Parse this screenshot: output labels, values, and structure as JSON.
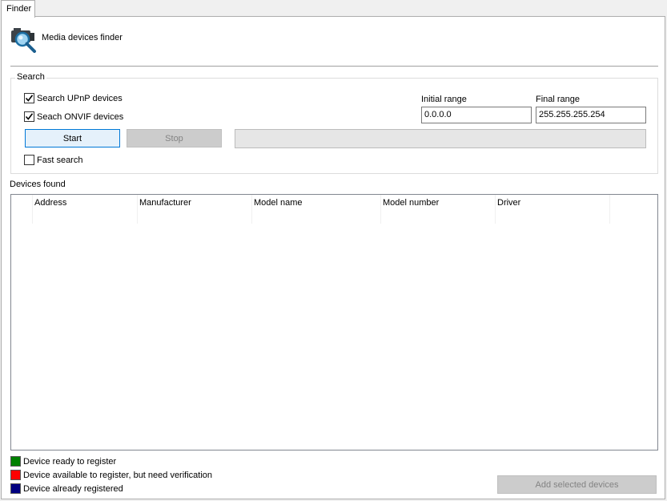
{
  "tab": {
    "label": "Finder"
  },
  "header": {
    "title": "Media devices finder",
    "icon": "camera-search-icon"
  },
  "search": {
    "group_label": "Search",
    "upnp": {
      "label": "Search UPnP devices",
      "checked": true
    },
    "onvif": {
      "label": "Seach ONVIF devices",
      "checked": true
    },
    "fast": {
      "label": "Fast search",
      "checked": false
    },
    "start_label": "Start",
    "stop_label": "Stop",
    "progress": 0,
    "initial_range": {
      "label": "Initial range",
      "value": "0.0.0.0"
    },
    "final_range": {
      "label": "Final range",
      "value": "255.255.255.254"
    }
  },
  "devices": {
    "label": "Devices found",
    "columns": [
      "Address",
      "Manufacturer",
      "Model name",
      "Model number",
      "Driver"
    ],
    "rows": []
  },
  "legend": [
    {
      "label": "Device ready to register",
      "color": "#008000"
    },
    {
      "label": "Device available to register, but need verification",
      "color": "#ff0000"
    },
    {
      "label": "Device already registered",
      "color": "#000080"
    }
  ],
  "footer": {
    "add_label": "Add selected devices"
  }
}
